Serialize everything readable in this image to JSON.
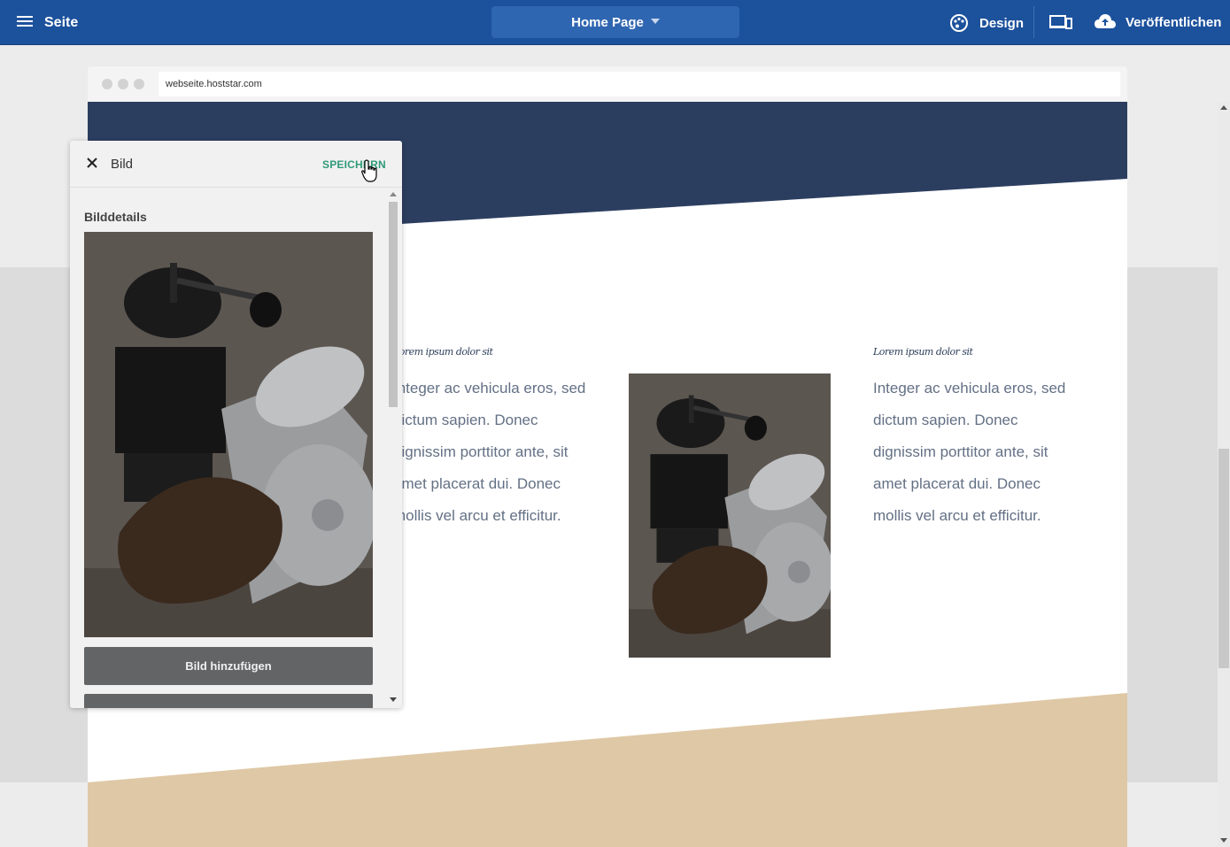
{
  "topbar": {
    "page_label": "Seite",
    "current_page": "Home Page",
    "design_label": "Design",
    "publish_label": "Veröffentlichen",
    "bg_color": "#1c519c"
  },
  "browser": {
    "url": "webseite.hoststar.com"
  },
  "site": {
    "header_color": "#2c3e60",
    "footer_color": "#dfc8a6",
    "col1": {
      "caption": "Lorem ipsum dolor sit",
      "lines": [
        "Integer ac vehicula eros, sed",
        "dictum sapien. Donec",
        "dignissim porttitor ante, sit",
        "amet placerat dui. Donec",
        "mollis vel arcu et efficitur."
      ]
    },
    "col2": {
      "caption": "Lorem ipsum dolor sit",
      "lines": [
        "Integer ac vehicula eros, sed",
        "dictum sapien. Donec",
        "dignissim porttitor ante, sit",
        "amet placerat dui. Donec",
        "mollis vel arcu et efficitur."
      ]
    }
  },
  "panel": {
    "title": "Bild",
    "save_label": "SPEICHERN",
    "section_title": "Bilddetails",
    "add_image_button": "Bild hinzufügen"
  }
}
